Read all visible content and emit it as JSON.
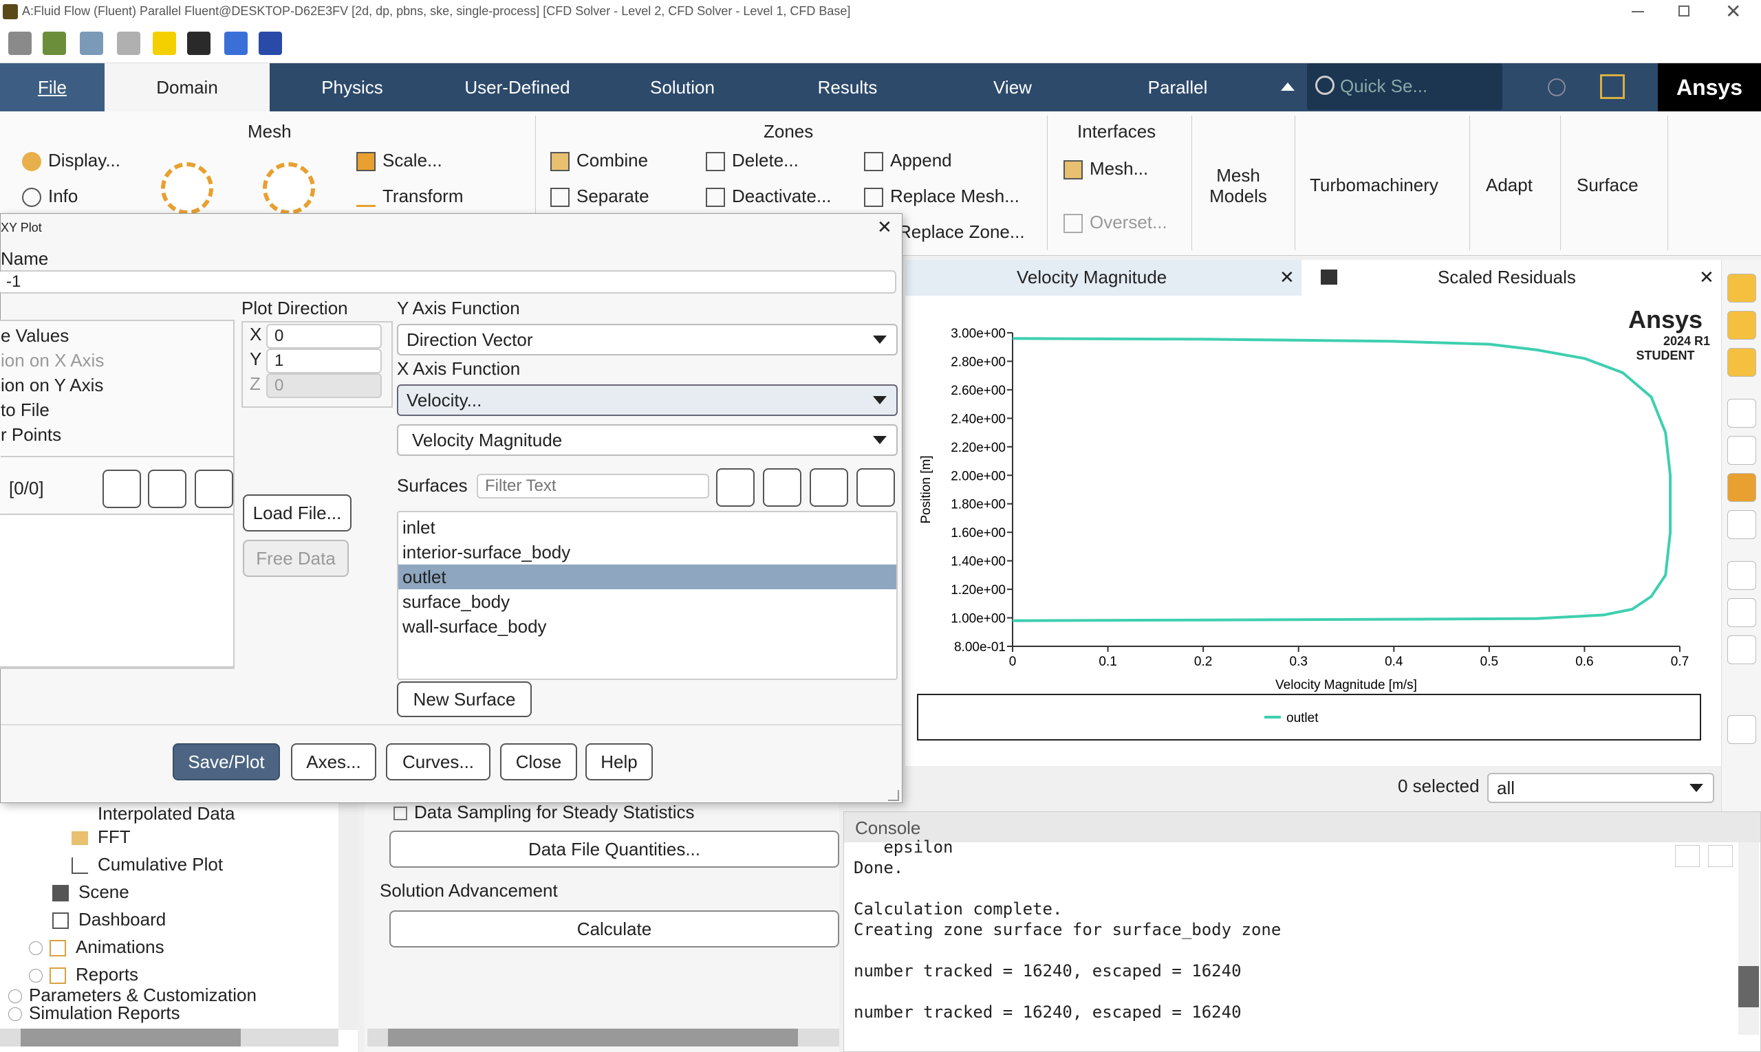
{
  "window": {
    "title": "A:Fluid Flow (Fluent) Parallel Fluent@DESKTOP-D62E3FV  [2d, dp, pbns, ske, single-process] [CFD Solver - Level 2, CFD Solver - Level 1, CFD Base]"
  },
  "toolbar_icons": [
    "open-case-icon",
    "save-icon",
    "print-icon",
    "refresh-icon",
    "lightning-icon",
    "workbench-icon",
    "parallel-transfer-icon",
    "moe-icon"
  ],
  "tabs": [
    "File",
    "Domain",
    "Physics",
    "User-Defined",
    "Solution",
    "Results",
    "View",
    "Parallel"
  ],
  "active_tab": "Domain",
  "search": {
    "placeholder": "Quick Se..."
  },
  "brand": "Ansys",
  "ribbon": {
    "mesh": {
      "title": "Mesh",
      "display": "Display...",
      "info": "Info",
      "scale": "Scale...",
      "transform": "Transform"
    },
    "zones": {
      "title": "Zones",
      "combine": "Combine",
      "separate": "Separate",
      "delete": "Delete...",
      "deactivate": "Deactivate...",
      "append": "Append",
      "replace_mesh": "Replace Mesh...",
      "replace_zone": "Replace Zone..."
    },
    "interfaces": {
      "title": "Interfaces",
      "mesh": "Mesh...",
      "overset": "Overset..."
    },
    "mesh_models": "Mesh\nModels",
    "turbomachinery": "Turbomachinery",
    "adapt": "Adapt",
    "surface": "Surface"
  },
  "dialog": {
    "title": "XY Plot",
    "name_label": "Name",
    "name_value": "-1",
    "options": [
      "e Values",
      "ion on X Axis",
      "ion on Y Axis",
      " to File",
      "r Points"
    ],
    "counter": "[0/0]",
    "plot_direction": {
      "label": "Plot Direction",
      "x": "0",
      "y": "1",
      "z": "0"
    },
    "load_file": "Load File...",
    "free_data": "Free Data",
    "y_axis_function_label": "Y Axis Function",
    "y_axis_function": "Direction Vector",
    "x_axis_function_label": "X Axis Function",
    "x_axis_function": "Velocity...",
    "x_axis_sub": "Velocity Magnitude",
    "surfaces_label": "Surfaces",
    "filter_placeholder": "Filter Text",
    "surfaces": [
      "inlet",
      "interior-surface_body",
      "outlet",
      "surface_body",
      "wall-surface_body"
    ],
    "selected_surface": "outlet",
    "new_surface": "New Surface",
    "buttons": {
      "save_plot": "Save/Plot",
      "axes": "Axes...",
      "curves": "Curves...",
      "close": "Close",
      "help": "Help"
    }
  },
  "graphics": {
    "tab1": "Velocity Magnitude",
    "tab2": "Scaled Residuals",
    "watermark": {
      "brand": "Ansys",
      "version": "2024 R1",
      "edition": "STUDENT"
    },
    "selected_text": "0 selected",
    "selection_filter": "all"
  },
  "chart_data": {
    "type": "line",
    "xlabel": "Velocity Magnitude [m/s]",
    "ylabel": "Position [m]",
    "xlim": [
      0,
      0.7
    ],
    "ylim": [
      0.8,
      3.0
    ],
    "xticks": [
      "0",
      "0.1",
      "0.2",
      "0.3",
      "0.4",
      "0.5",
      "0.6",
      "0.7"
    ],
    "yticks": [
      "8.00e-01",
      "1.00e+00",
      "1.20e+00",
      "1.40e+00",
      "1.60e+00",
      "1.80e+00",
      "2.00e+00",
      "2.20e+00",
      "2.40e+00",
      "2.60e+00",
      "2.80e+00",
      "3.00e+00"
    ],
    "legend_position": "bottom",
    "grid": false,
    "series": [
      {
        "name": "outlet",
        "color": "#3ecfb0",
        "points": [
          [
            0.0,
            0.98
          ],
          [
            0.2,
            0.985
          ],
          [
            0.4,
            0.99
          ],
          [
            0.55,
            0.995
          ],
          [
            0.62,
            1.02
          ],
          [
            0.65,
            1.06
          ],
          [
            0.67,
            1.15
          ],
          [
            0.685,
            1.3
          ],
          [
            0.69,
            1.6
          ],
          [
            0.69,
            2.0
          ],
          [
            0.685,
            2.3
          ],
          [
            0.67,
            2.55
          ],
          [
            0.64,
            2.72
          ],
          [
            0.6,
            2.82
          ],
          [
            0.55,
            2.88
          ],
          [
            0.5,
            2.92
          ],
          [
            0.4,
            2.94
          ],
          [
            0.2,
            2.955
          ],
          [
            0.0,
            2.96
          ]
        ]
      }
    ]
  },
  "tree": {
    "items": [
      "Interpolated Data",
      "FFT",
      "Cumulative Plot",
      "Scene",
      "Dashboard",
      "Animations",
      "Reports",
      "Parameters & Customization",
      "Simulation Reports"
    ]
  },
  "task_page": {
    "data_sampling": "Data Sampling for Steady Statistics",
    "data_file_quantities": "Data File Quantities...",
    "solution_advancement": "Solution Advancement",
    "calculate": "Calculate"
  },
  "console": {
    "title": "Console",
    "lines": [
      "   epsilon",
      "Done.",
      "",
      "Calculation complete.",
      "Creating zone surface for surface_body zone",
      "",
      "number tracked = 16240, escaped = 16240",
      "",
      "number tracked = 16240, escaped = 16240"
    ]
  }
}
